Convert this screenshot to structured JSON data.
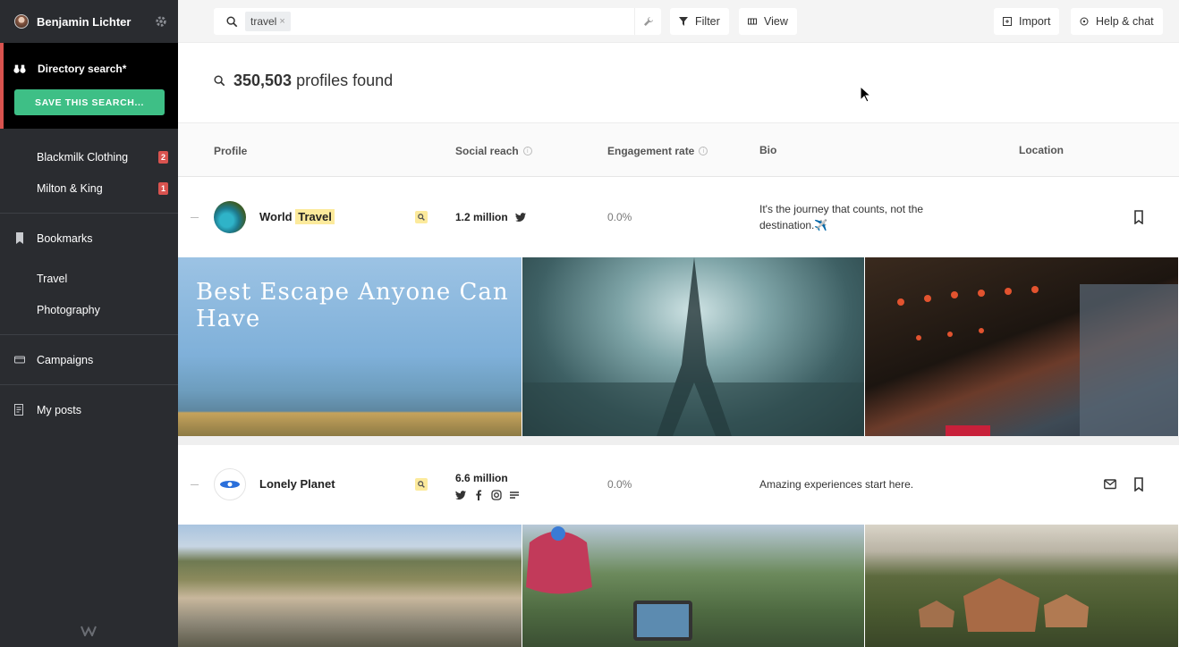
{
  "sidebar": {
    "user_name": "Benjamin Lichter",
    "active_item": "Directory search*",
    "save_button": "SAVE THIS SEARCH...",
    "clients": [
      {
        "label": "Blackmilk Clothing",
        "count": "2"
      },
      {
        "label": "Milton & King",
        "count": "1"
      }
    ],
    "bookmarks_label": "Bookmarks",
    "bookmark_lists": [
      {
        "label": "Travel"
      },
      {
        "label": "Photography"
      }
    ],
    "campaigns_label": "Campaigns",
    "my_posts_label": "My posts"
  },
  "topbar": {
    "search_chip": "travel",
    "filter_label": "Filter",
    "view_label": "View",
    "import_label": "Import",
    "help_label": "Help & chat"
  },
  "results": {
    "count": "350,503",
    "suffix": "profiles found"
  },
  "table": {
    "columns": [
      "Profile",
      "Social reach",
      "Engagement rate",
      "Bio",
      "Location"
    ]
  },
  "rows": [
    {
      "name_prefix": "World",
      "name_highlight": "Travel",
      "reach": "1.2 million",
      "engagement": "0.0%",
      "bio": "It's the journey that counts, not the destination.✈️",
      "photo_caption": "Best Escape Anyone Can Have"
    },
    {
      "name": "Lonely Planet",
      "reach": "6.6 million",
      "engagement": "0.0%",
      "bio": "Amazing experiences start here."
    }
  ],
  "colors": {
    "sidebar_bg": "#2a2c30",
    "accent_red": "#d9534f",
    "save_green": "#3ebf86",
    "highlight": "#fcea9c"
  }
}
